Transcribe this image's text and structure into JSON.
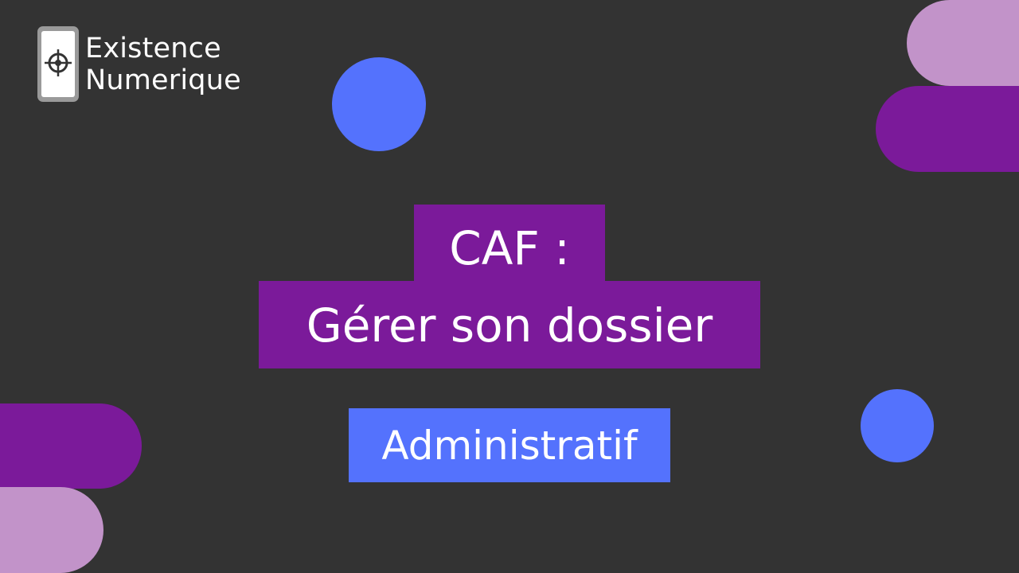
{
  "brand": {
    "line1": "Existence",
    "line2": "Numerique",
    "logo_icon": "phone-compass-icon"
  },
  "title": {
    "line1": "CAF :",
    "line2": "Gérer son dossier"
  },
  "category": "Administratif",
  "colors": {
    "background": "#333333",
    "purple_dark": "#7b1a9a",
    "purple_light": "#c293c9",
    "blue": "#5472fd",
    "text": "#ffffff"
  }
}
